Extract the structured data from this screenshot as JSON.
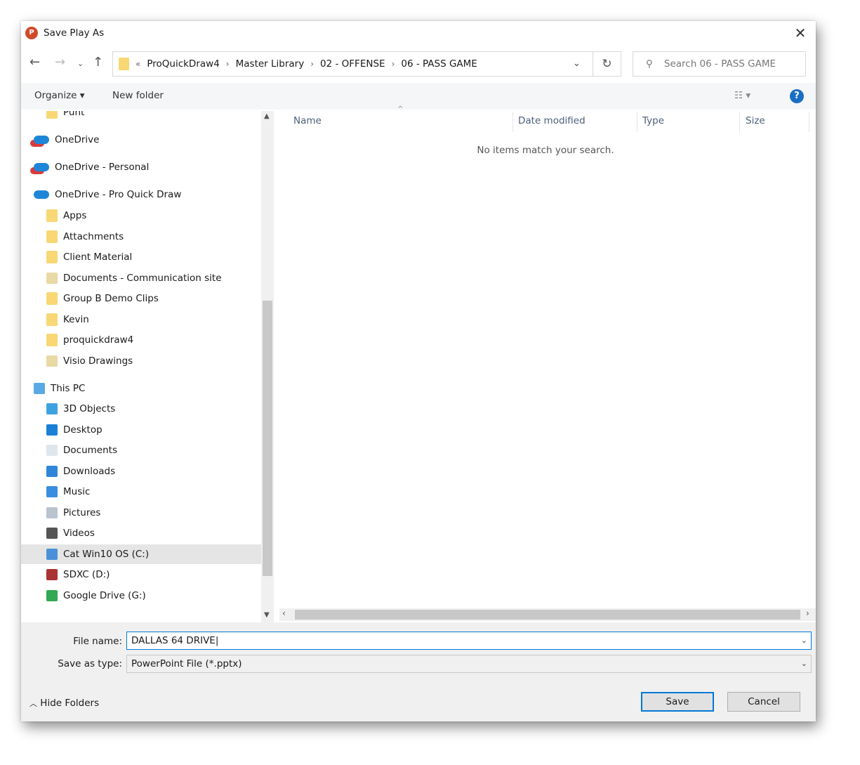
{
  "window": {
    "title": "Save Play As",
    "close": "✕"
  },
  "address": {
    "crumbs": [
      "ProQuickDraw4",
      "Master Library",
      "02 - OFFENSE",
      "06 - PASS GAME"
    ],
    "overflow": "«"
  },
  "search": {
    "placeholder": "Search 06 - PASS GAME"
  },
  "toolbar": {
    "organize": "Organize ▾",
    "new_folder": "New folder",
    "help": "?"
  },
  "nav": {
    "items": [
      {
        "label": "Punt",
        "icon": "folder-icon",
        "indent": 1
      },
      {
        "label": "OneDrive",
        "icon": "onedrive-error-icon",
        "indent": 0
      },
      {
        "label": "OneDrive - Personal",
        "icon": "onedrive-error-icon",
        "indent": 0
      },
      {
        "label": "OneDrive - Pro Quick Draw",
        "icon": "onedrive-icon",
        "indent": 0
      },
      {
        "label": "Apps",
        "icon": "folder-icon",
        "indent": 1
      },
      {
        "label": "Attachments",
        "icon": "folder-icon",
        "indent": 1
      },
      {
        "label": "Client Material",
        "icon": "folder-icon",
        "indent": 1
      },
      {
        "label": "Documents - Communication site",
        "icon": "shared-folder-icon",
        "indent": 1
      },
      {
        "label": "Group B Demo Clips",
        "icon": "folder-icon",
        "indent": 1
      },
      {
        "label": "Kevin",
        "icon": "folder-icon",
        "indent": 1
      },
      {
        "label": "proquickdraw4",
        "icon": "folder-icon",
        "indent": 1
      },
      {
        "label": "Visio Drawings",
        "icon": "shared-folder-icon",
        "indent": 1
      },
      {
        "label": "This PC",
        "icon": "pc-icon",
        "indent": 0
      },
      {
        "label": "3D Objects",
        "icon": "3d-objects-icon",
        "indent": 1
      },
      {
        "label": "Desktop",
        "icon": "desktop-icon",
        "indent": 1
      },
      {
        "label": "Documents",
        "icon": "documents-icon",
        "indent": 1
      },
      {
        "label": "Downloads",
        "icon": "downloads-icon",
        "indent": 1
      },
      {
        "label": "Music",
        "icon": "music-icon",
        "indent": 1
      },
      {
        "label": "Pictures",
        "icon": "pictures-icon",
        "indent": 1
      },
      {
        "label": "Videos",
        "icon": "videos-icon",
        "indent": 1
      },
      {
        "label": "Cat Win10 OS (C:)",
        "icon": "drive-icon",
        "indent": 1,
        "selected": true
      },
      {
        "label": "SDXC (D:)",
        "icon": "sd-card-icon",
        "indent": 1
      },
      {
        "label": "Google Drive (G:)",
        "icon": "google-drive-icon",
        "indent": 1
      }
    ]
  },
  "columns": [
    "Name",
    "Date modified",
    "Type",
    "Size"
  ],
  "empty_message": "No items match your search.",
  "form": {
    "file_name_label": "File name:",
    "file_name": "DALLAS 64 DRIVE",
    "type_label": "Save as type:",
    "type": "PowerPoint File (*.pptx)"
  },
  "footer": {
    "hide_folders": "Hide Folders",
    "save": "Save",
    "cancel": "Cancel"
  }
}
